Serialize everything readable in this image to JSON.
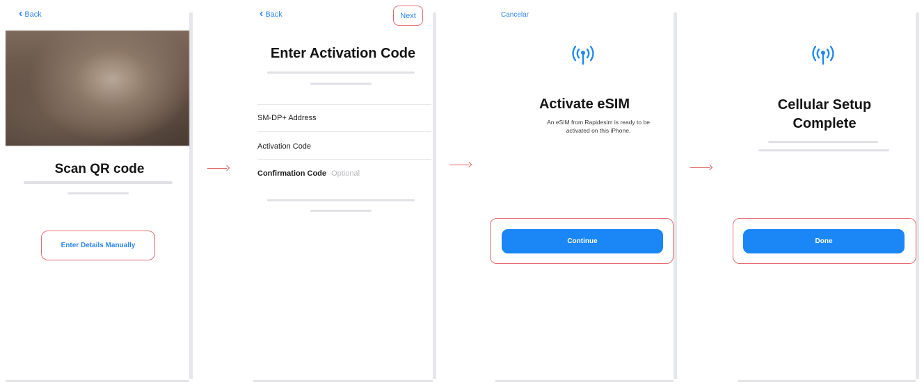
{
  "screen1": {
    "back_label": "Back",
    "title": "Scan QR code",
    "manual_button": "Enter Details Manually"
  },
  "screen2": {
    "back_label": "Back",
    "next_label": "Next",
    "title": "Enter Activation Code",
    "fields": [
      {
        "label": "SM-DP+ Address",
        "hint": ""
      },
      {
        "label": "Activation Code",
        "hint": ""
      },
      {
        "label": "Confirmation Code",
        "hint": "Optional"
      }
    ]
  },
  "screen3": {
    "cancel_label": "Cancelar",
    "title": "Activate eSIM",
    "subtitle": "An eSIM from Rapidesim is ready to be activated on this iPhone.",
    "continue_label": "Continue"
  },
  "screen4": {
    "title": "Cellular Setup Complete",
    "done_label": "Done"
  },
  "colors": {
    "accent": "#1b86f5",
    "link": "#2f86f6",
    "highlight": "#e56b70",
    "arrow": "#e0635f"
  },
  "icons": [
    "chevron-left-icon",
    "antenna-icon",
    "arrow-right-icon"
  ]
}
